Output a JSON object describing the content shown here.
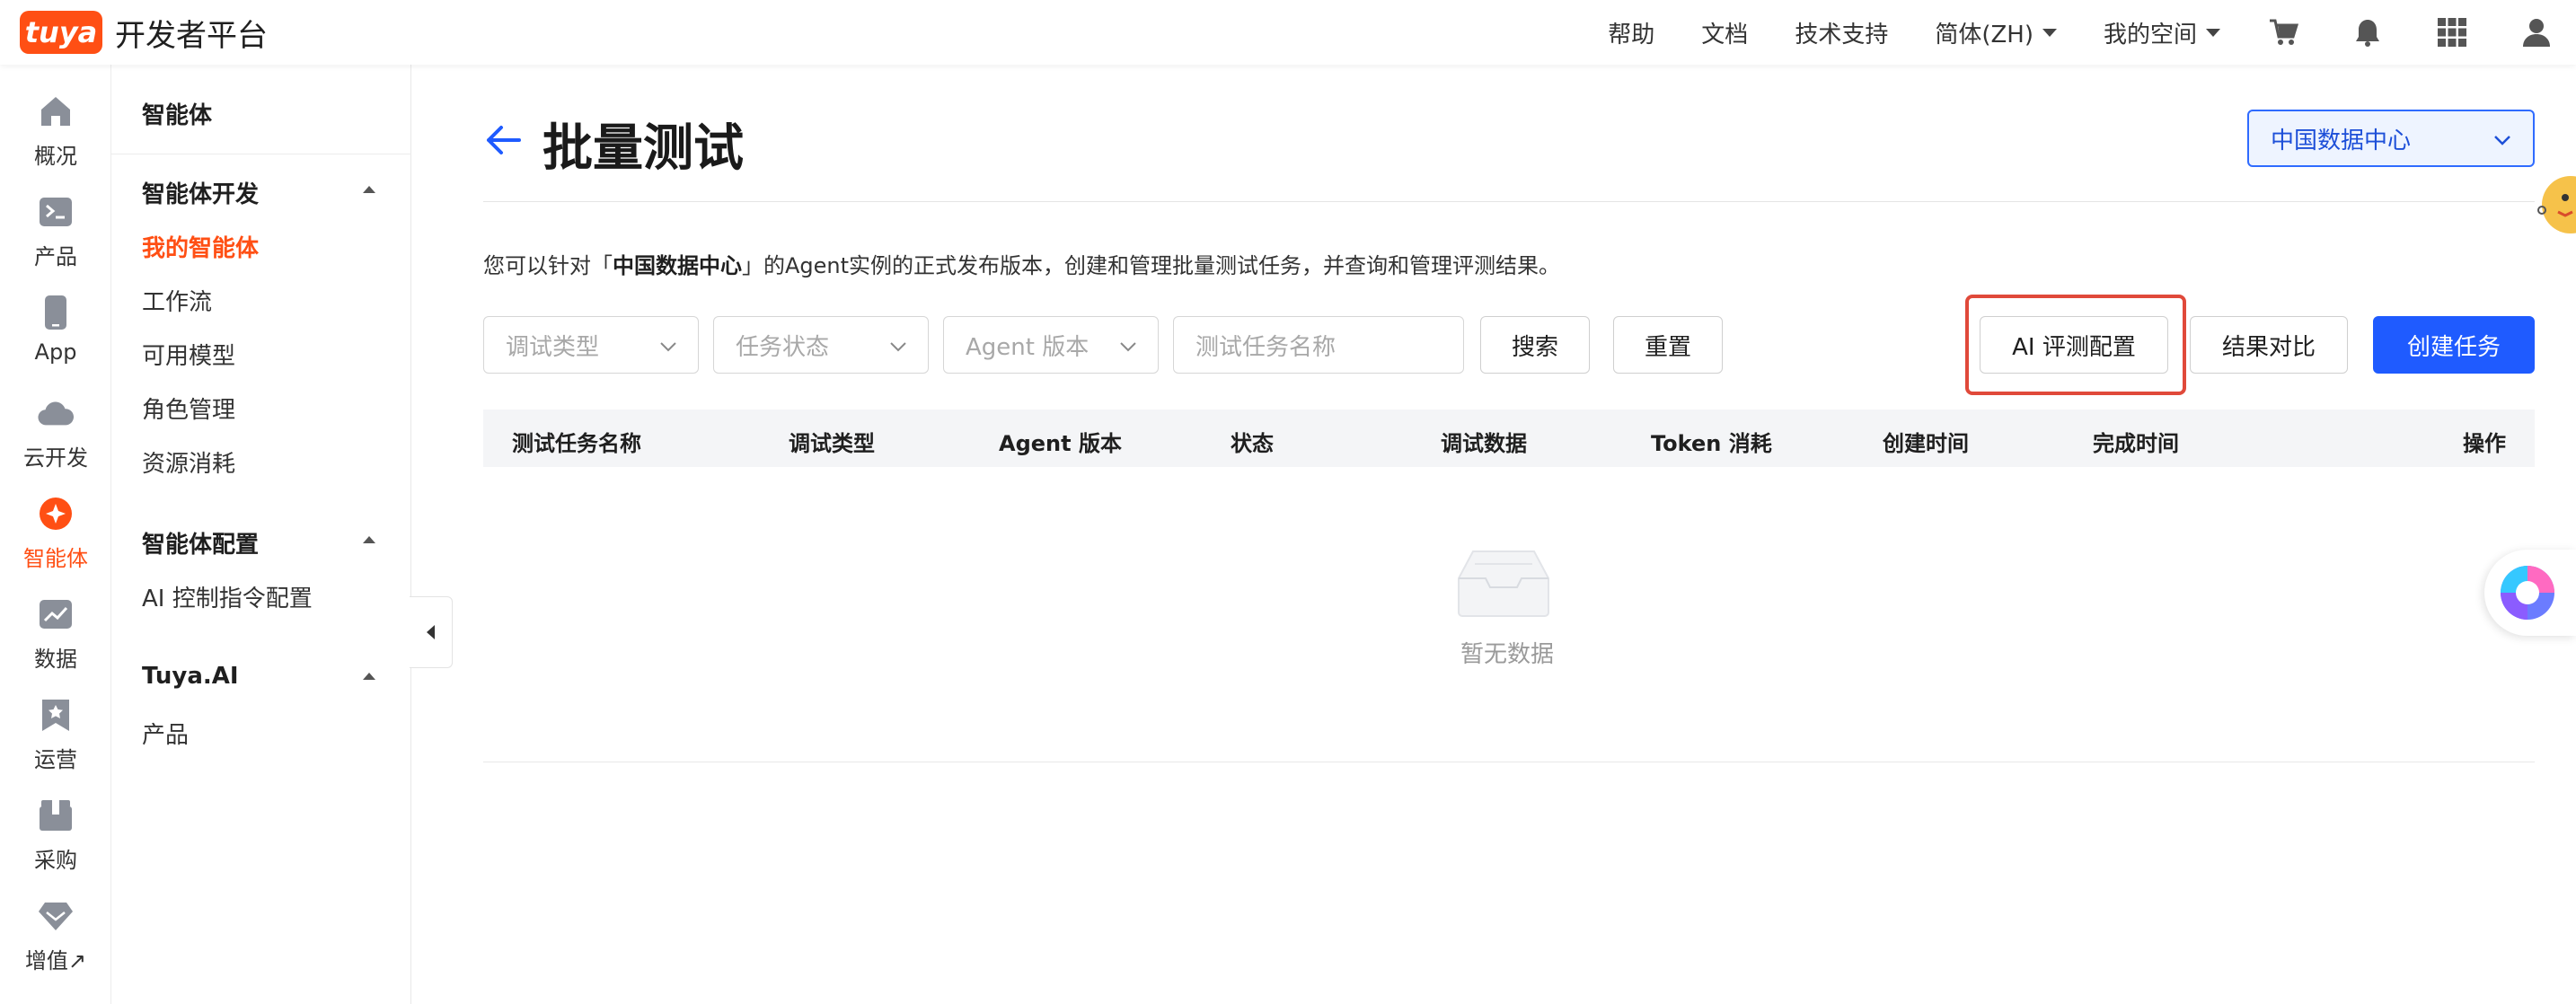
{
  "brand": {
    "logo_text": "tuya",
    "title": "开发者平台"
  },
  "topnav": {
    "help": "帮助",
    "docs": "文档",
    "support": "技术支持",
    "language": "简体(ZH)",
    "workspace": "我的空间",
    "icons": [
      "cart-icon",
      "bell-icon",
      "apps-grid-icon",
      "user-icon"
    ]
  },
  "rail": {
    "items": [
      {
        "label": "概况",
        "icon": "home-icon"
      },
      {
        "label": "产品",
        "icon": "terminal-icon"
      },
      {
        "label": "App",
        "icon": "phone-icon"
      },
      {
        "label": "云开发",
        "icon": "cloud-icon"
      },
      {
        "label": "智能体",
        "icon": "agent-star-icon",
        "active": true
      },
      {
        "label": "数据",
        "icon": "chart-icon"
      },
      {
        "label": "运营",
        "icon": "bookmark-star-icon"
      },
      {
        "label": "采购",
        "icon": "box-icon"
      },
      {
        "label": "增值↗",
        "icon": "diamond-icon"
      }
    ]
  },
  "submenu": {
    "header": "智能体",
    "group1": {
      "title": "智能体开发",
      "items": [
        "我的智能体",
        "工作流",
        "可用模型",
        "角色管理",
        "资源消耗"
      ]
    },
    "group2": {
      "title": "智能体配置",
      "items": [
        "AI 控制指令配置"
      ]
    },
    "group3": {
      "title": "Tuya.AI",
      "items": [
        "产品"
      ]
    }
  },
  "main": {
    "title": "批量测试",
    "region": "中国数据中心",
    "desc_prefix": "您可以针对「",
    "desc_bold": "中国数据中心",
    "desc_suffix": "」的Agent实例的正式发布版本，创建和管理批量测试任务，并查询和管理评测结果。",
    "filters": {
      "debug_type": "调试类型",
      "task_status": "任务状态",
      "agent_version": "Agent 版本",
      "task_name_placeholder": "测试任务名称"
    },
    "buttons": {
      "search": "搜索",
      "reset": "重置",
      "ai_eval_config": "AI 评测配置",
      "compare": "结果对比",
      "create_task": "创建任务"
    },
    "table": {
      "columns": [
        "测试任务名称",
        "调试类型",
        "Agent 版本",
        "状态",
        "调试数据",
        "Token 消耗",
        "创建时间",
        "完成时间",
        "操作"
      ]
    },
    "empty_text": "暂无数据"
  },
  "colors": {
    "brand_orange": "#ff4f14",
    "primary_blue": "#1f5bff",
    "highlight_red": "#e0493a"
  }
}
